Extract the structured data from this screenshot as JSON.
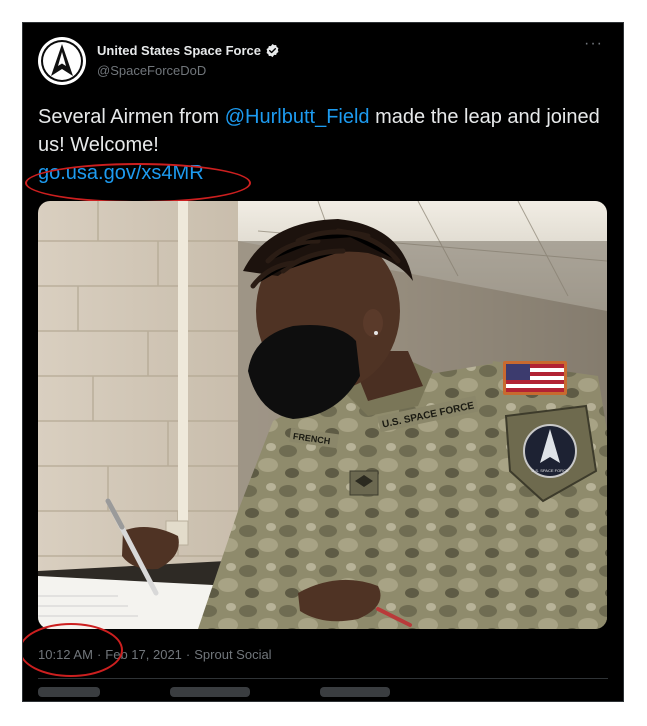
{
  "tweet": {
    "author": {
      "display_name": "United States Space Force",
      "handle": "@SpaceForceDoD",
      "verified": true,
      "avatar_icon": "space-force-delta-logo"
    },
    "more_icon": "more-horizontal-icon",
    "more_glyph": "···",
    "text": {
      "prefix": "Several Airmen from ",
      "mention": "@Hurlbutt_Field",
      "suffix": " made the leap and joined us! Welcome!",
      "link": "go.usa.gov/xs4MR"
    },
    "photo": {
      "nametape": "FRENCH",
      "branch_tape": "U.S. SPACE FORCE",
      "patch_text": "U.S. SPACE FORCE"
    },
    "meta": {
      "time": "10:12 AM",
      "date": "Feb 17, 2021",
      "source": "Sprout Social",
      "separator": "·"
    }
  },
  "colors": {
    "background": "#000000",
    "text": "#e7e9ea",
    "muted": "#71767b",
    "link": "#1d9bf0",
    "annotation": "#cc1f1f"
  }
}
